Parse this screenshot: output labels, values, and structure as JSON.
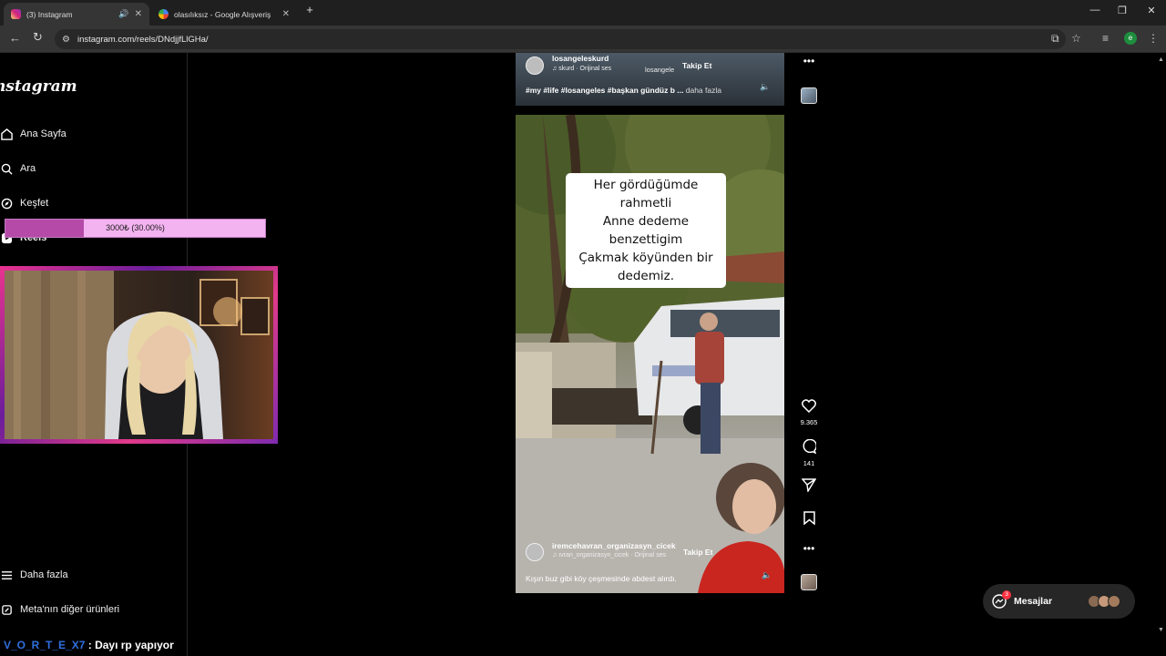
{
  "browser": {
    "tabs": [
      {
        "title": "(3) Instagram",
        "active": true
      },
      {
        "title": "olasılıksız - Google Alışveriş",
        "active": false
      }
    ],
    "url": "instagram.com/reels/DNdjjfLlGHa/",
    "profile_initial": "e"
  },
  "sidebar": {
    "logo": "Instagram",
    "items": [
      {
        "label": "Ana Sayfa",
        "icon": "home-icon"
      },
      {
        "label": "Ara",
        "icon": "search-icon"
      },
      {
        "label": "Keşfet",
        "icon": "compass-icon"
      },
      {
        "label": "Reels",
        "icon": "reels-icon"
      }
    ],
    "bottom": [
      {
        "label": "Daha fazla",
        "icon": "menu-icon"
      },
      {
        "label": "Meta'nın diğer ürünleri",
        "icon": "meta-icon"
      }
    ]
  },
  "donation": {
    "text": "3000₺ (30.00%)",
    "progress": 0.3
  },
  "reel_top": {
    "username": "losangeleskurd",
    "audio": "skurd · Orijinal ses",
    "location": "losangele",
    "follow": "Takip Et",
    "caption": "#my #life #losangeles #başkan gündüz b ...",
    "more": "daha fazla"
  },
  "reel_main": {
    "overlay_text": [
      "Her gördüğümde rahmetli",
      "Anne dedeme benzettigim",
      "Çakmak köyünden bir",
      "dedemiz."
    ],
    "username": "iremcehavran_organizasyn_cicek",
    "audio": "ıvran_organizasyn_cicek · Orijinal ses",
    "follow": "Takip Et",
    "caption": "Kışın buz gibi köy çeşmesinde abdest alırdı."
  },
  "actions": {
    "likes": "9.365",
    "comments": "141"
  },
  "messages": {
    "label": "Mesajlar",
    "badge": "3"
  },
  "chat": {
    "user": "V_O_R_T_E_X7",
    "separator": " : ",
    "message": "Dayı rp yapıyor",
    "user_color": "#2f6fe0"
  },
  "colors": {
    "instagram_tab": "#d6249f",
    "donation_fill": "#b54aa8",
    "donation_bg": "#f3b3f0",
    "profile": "#1e8e3e"
  }
}
